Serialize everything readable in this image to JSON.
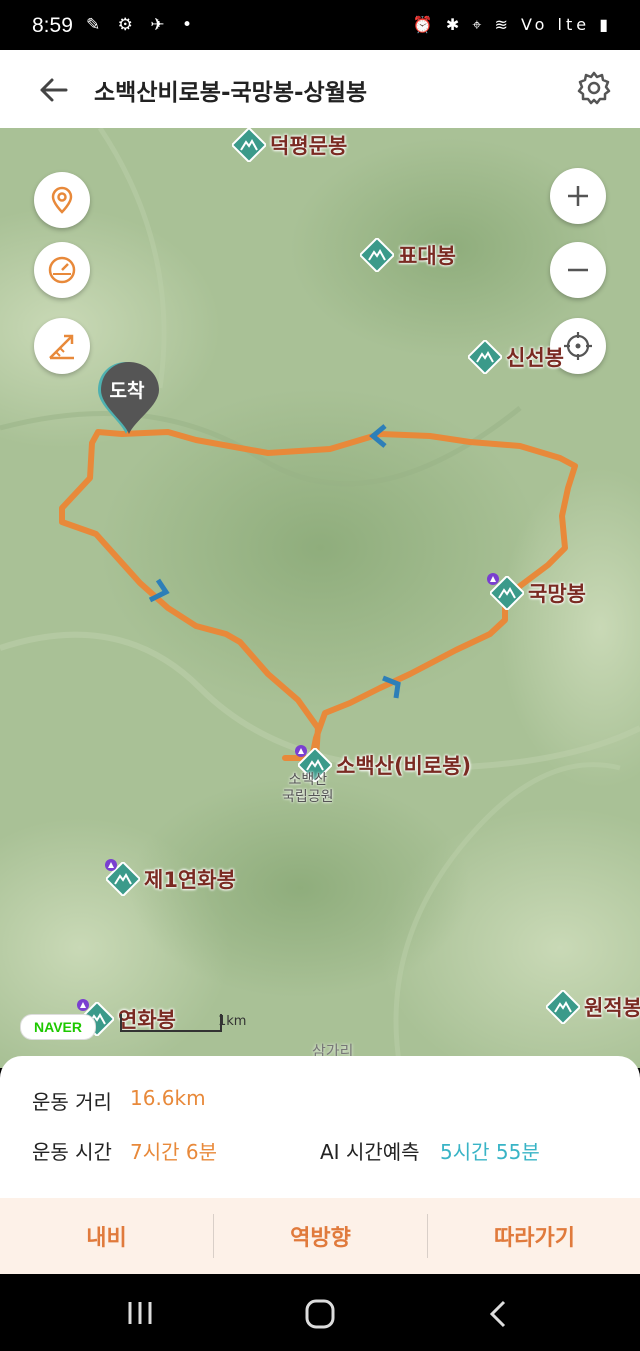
{
  "status_bar": {
    "time": "8:59",
    "left_icons": "✎ ⚙ ✈ •",
    "right_icons": "⏰ ✱ ⌖ ≋ Vo lte ▮"
  },
  "header": {
    "title": "소백산비로봉-국망봉-상월봉",
    "back_icon": "arrow-left-icon",
    "settings_icon": "gear-icon"
  },
  "map": {
    "arrival_label": "도착",
    "peaks": [
      {
        "name": "덕평문봉",
        "triangle": false
      },
      {
        "name": "표대봉",
        "triangle": false
      },
      {
        "name": "신선봉",
        "triangle": false
      },
      {
        "name": "국망봉",
        "triangle": true
      },
      {
        "name": "소백산(비로봉)",
        "triangle": true
      },
      {
        "name": "제1연화봉",
        "triangle": true
      },
      {
        "name": "연화봉",
        "triangle": true
      },
      {
        "name": "원적봉",
        "triangle": false
      }
    ],
    "park_label": "소백산\n국립공원",
    "village_label": "삼가리",
    "naver_logo": "NAVER",
    "scale_label": "1km",
    "route_color": "#e8893a"
  },
  "info": {
    "distance_label": "운동 거리",
    "distance_value": "16.6km",
    "time_label": "운동 시간",
    "time_value": "7시간 6분",
    "ai_label": "AI 시간예측",
    "ai_value": "5시간 55분"
  },
  "actions": [
    {
      "label": "내비"
    },
    {
      "label": "역방향"
    },
    {
      "label": "따라가기"
    }
  ],
  "colors": {
    "accent": "#e8893a",
    "teal": "#39b4c6",
    "peak_icon": "#3b9a8a",
    "peak_text": "#7a2a22"
  }
}
